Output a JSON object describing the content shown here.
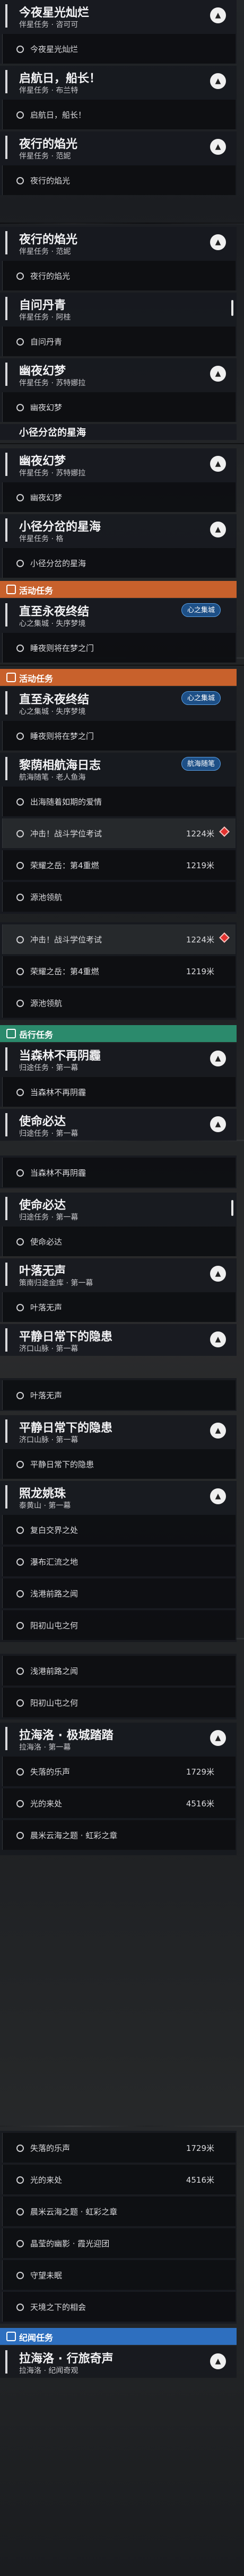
{
  "quests": {
    "q1": {
      "title": "今夜星光灿烂",
      "sub": "伴星任务 · 咨可可",
      "obj": "今夜星光灿烂"
    },
    "q2": {
      "title": "启航日，船长！",
      "sub": "伴星任务 · 布兰特",
      "obj": "启航日，船长！"
    },
    "q3": {
      "title": "夜行的焰光",
      "sub": "伴星任务 · 范妮",
      "obj": "夜行的焰光"
    },
    "q4": {
      "title": "夜行的焰光",
      "sub": "伴星任务 · 范妮",
      "obj": "夜行的焰光"
    },
    "q5": {
      "title": "自问丹青",
      "sub": "伴星任务 · 阿桂",
      "obj": "自问丹青"
    },
    "q6": {
      "title": "幽夜幻梦",
      "sub": "伴星任务 · 苏特娜拉",
      "obj": "幽夜幻梦"
    },
    "q7": {
      "title": "小径分岔的星海",
      "sub": ""
    },
    "q8": {
      "title": "幽夜幻梦",
      "sub": "伴星任务 · 苏特娜拉",
      "obj": "幽夜幻梦"
    },
    "q9": {
      "title": "小径分岔的星海",
      "sub": "伴星任务 · 格",
      "obj": "小径分岔的星海"
    },
    "q10": {
      "title": "直至永夜终结",
      "sub": "心之集城 · 失序梦境",
      "obj": "睡夜则将在梦之门",
      "badge": "心之集城"
    },
    "q11": {
      "title": "直至永夜终结",
      "sub": "心之集城 · 失序梦境",
      "obj": "睡夜则将在梦之门",
      "badge": "心之集城"
    },
    "q12": {
      "title": "黎荫相航海日志",
      "sub": "航海随笔 · 老人鱼海",
      "badge": "航海随笔",
      "objs": [
        "出海随着如期的爱情",
        "冲击！战斗学位考试",
        "荣耀之岳：第4重燃",
        "源池领航"
      ],
      "dists": [
        "",
        "1224米",
        "1219米",
        ""
      ]
    },
    "q13": {
      "objs": [
        "冲击！战斗学位考试",
        "荣耀之岳：第4重燃",
        "源池领航"
      ],
      "dists": [
        "1224米",
        "1219米",
        ""
      ]
    },
    "q14": {
      "title": "当森林不再阴霾",
      "sub": "归途任务 · 第一幕",
      "obj": "当森林不再阴霾"
    },
    "q15": {
      "title": "使命必达",
      "sub": "归途任务 · 第一幕"
    },
    "q16": {
      "obj": "当森林不再阴霾"
    },
    "q17": {
      "title": "使命必达",
      "sub": "归途任务 · 第一幕",
      "obj": "使命必达"
    },
    "q18": {
      "title": "叶落无声",
      "sub": "策南归途金库 · 第一幕",
      "obj": "叶落无声"
    },
    "q19": {
      "title": "平静日常下的隐患",
      "sub": "济口山脉 · 第一幕"
    },
    "q20": {
      "obj": "叶落无声"
    },
    "q21": {
      "title": "平静日常下的隐患",
      "sub": "济口山脉 · 第一幕",
      "obj": "平静日常下的隐患"
    },
    "q22": {
      "title": "照龙姚珠",
      "sub": "泰黄山 · 第一幕",
      "objs": [
        "复白交界之处",
        "瀑布汇流之地",
        "浅港前路之闻",
        "阳初山屯之何"
      ]
    },
    "q23": {
      "objs": [
        "浅港前路之闻",
        "阳初山屯之何"
      ]
    },
    "q24": {
      "title": "拉海洛 · 极城踏踏",
      "sub": "拉海洛 · 第一幕",
      "objs": [
        "失落的乐声",
        "光的来处",
        "晨米云海之题 · 虹彩之章"
      ],
      "dists": [
        "1729米",
        "4516米",
        ""
      ]
    },
    "q25": {
      "objs": [
        "失落的乐声",
        "光的来处",
        "晨米云海之题 · 虹彩之章",
        "晶莹的幽影 · 霞光迎团",
        "守望未眠",
        "天境之下的相会"
      ],
      "dists": [
        "1729米",
        "4516米",
        "",
        "",
        "",
        ""
      ]
    },
    "q26": {
      "title": "拉海洛 · 行旅奇声",
      "sub": "拉海洛 · 纪闻奇观"
    }
  },
  "tags": {
    "event": "活动任务",
    "event2": "活动任务",
    "daily": "岳行任务",
    "trust": "纪闻任务"
  },
  "icons": {
    "collapse": "chevron-up-icon",
    "objective": "ring-icon",
    "marker": "diamond-marker-icon"
  },
  "colors": {
    "event": "#c8612c",
    "daily": "#2b8a6c",
    "trust": "#2e6fbf",
    "badge": "#1d4f86"
  }
}
